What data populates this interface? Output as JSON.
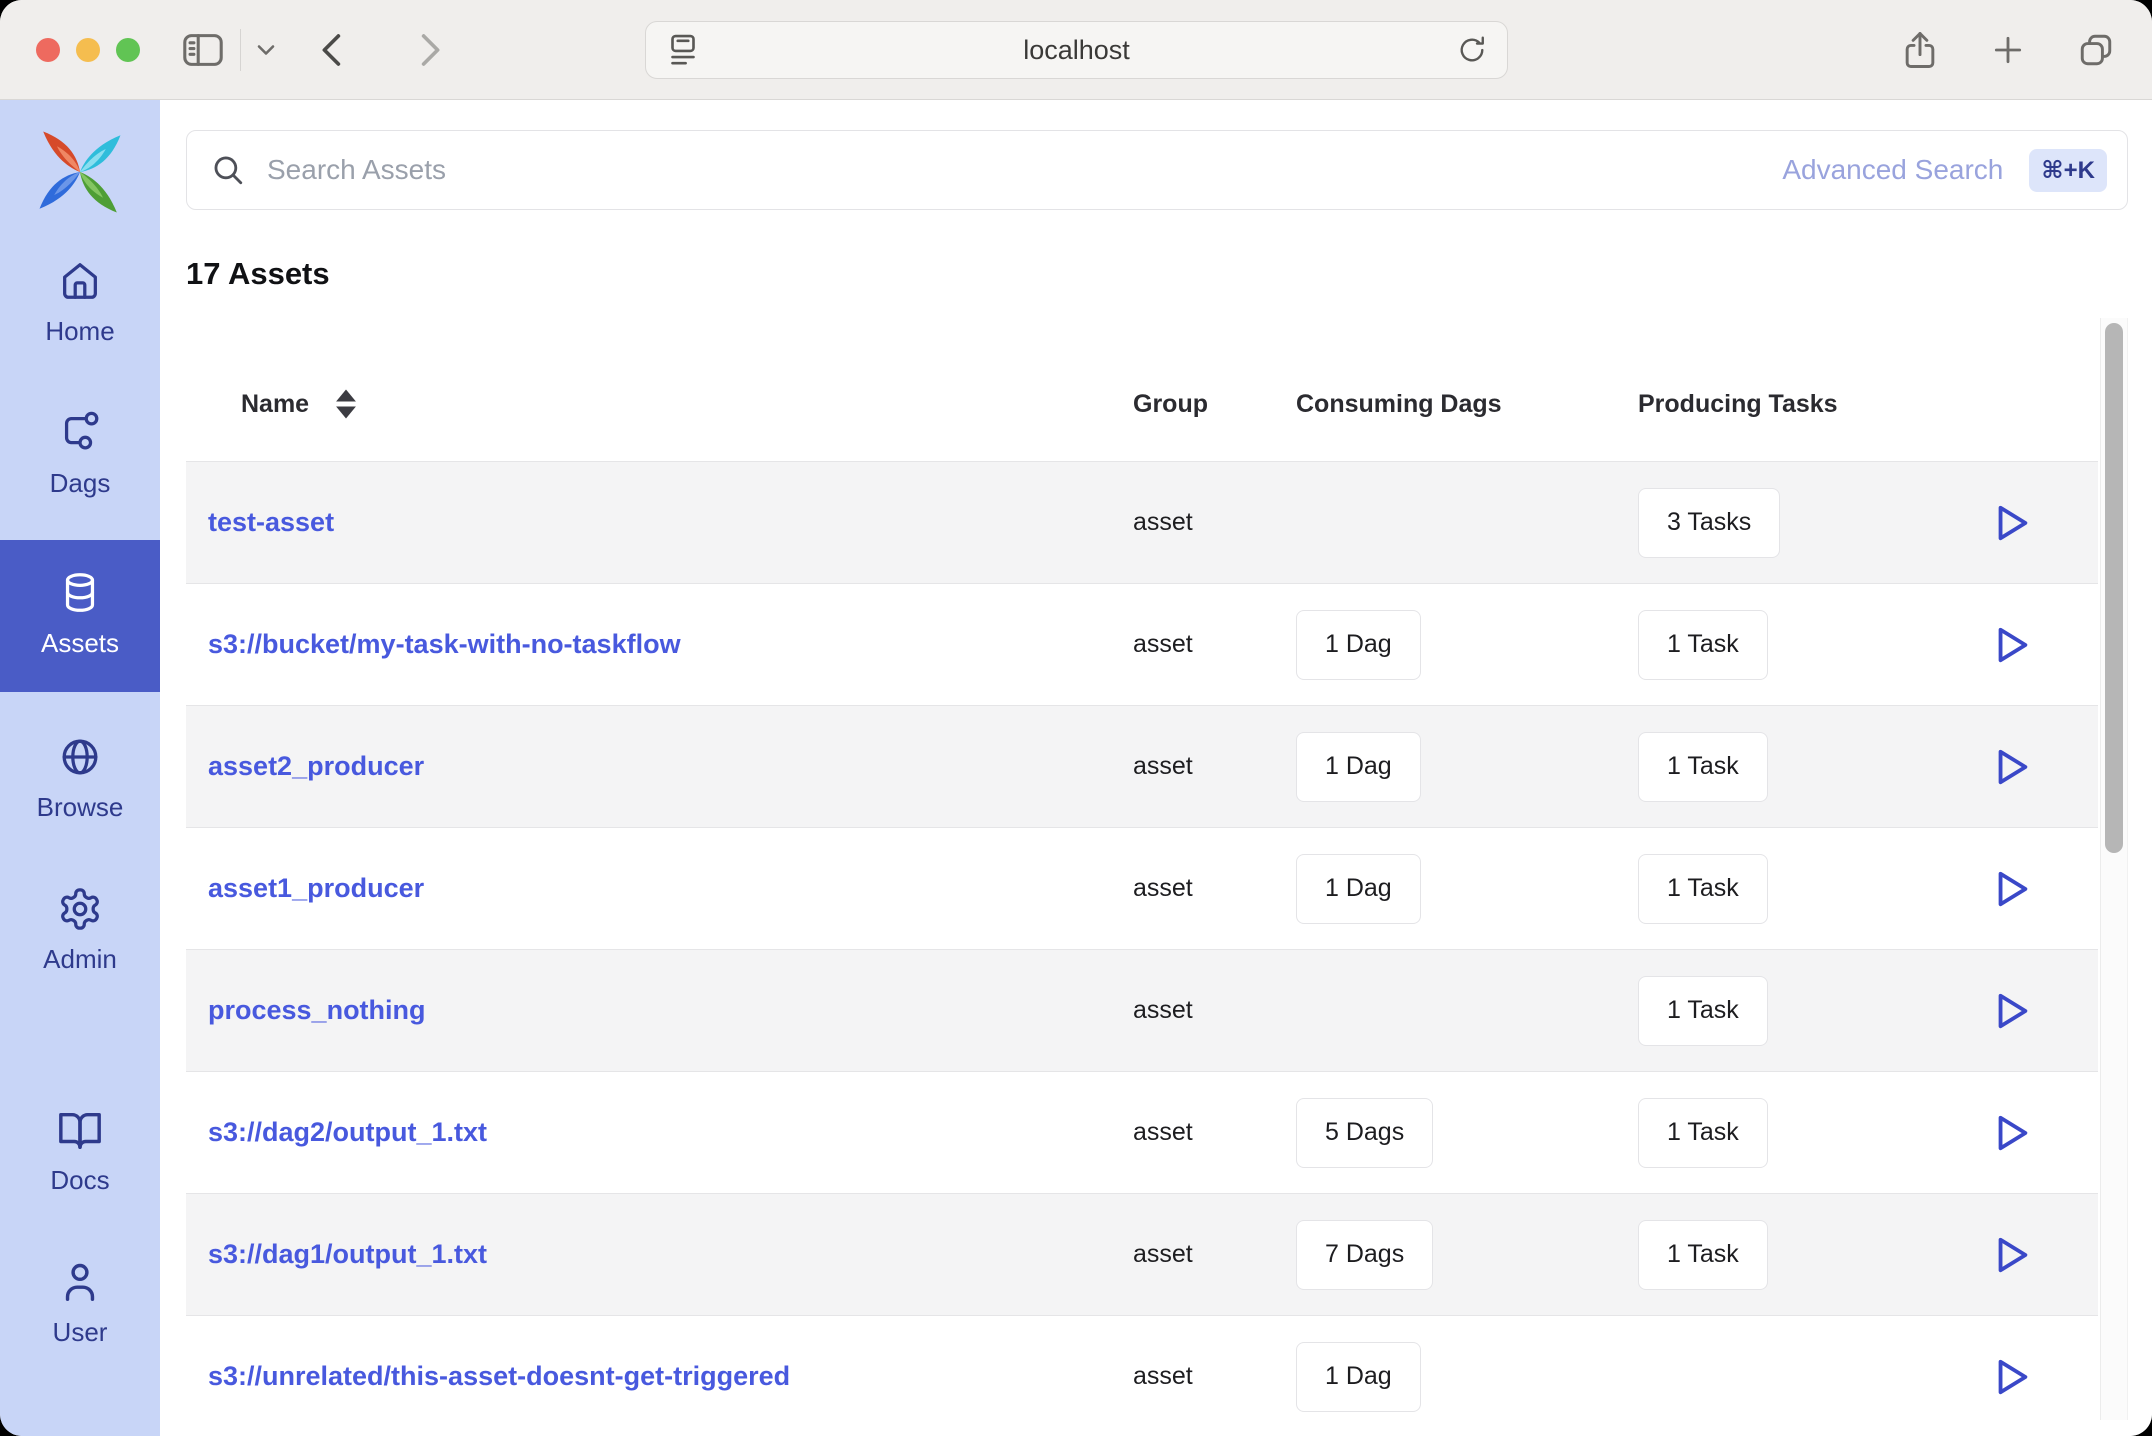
{
  "browser": {
    "url": "localhost"
  },
  "sidebar": {
    "items": [
      {
        "label": "Home",
        "icon": "home-icon",
        "active": false
      },
      {
        "label": "Dags",
        "icon": "dag-icon",
        "active": false
      },
      {
        "label": "Assets",
        "icon": "database-icon",
        "active": true
      },
      {
        "label": "Browse",
        "icon": "globe-icon",
        "active": false
      },
      {
        "label": "Admin",
        "icon": "gear-icon",
        "active": false
      }
    ],
    "footer_items": [
      {
        "label": "Docs",
        "icon": "book-icon"
      },
      {
        "label": "User",
        "icon": "user-icon"
      }
    ]
  },
  "search": {
    "placeholder": "Search Assets",
    "advanced_label": "Advanced Search",
    "shortcut": "⌘+K"
  },
  "heading": "17 Assets",
  "table": {
    "columns": [
      "Name",
      "Group",
      "Consuming Dags",
      "Producing Tasks"
    ],
    "rows": [
      {
        "name": "test-asset",
        "group": "asset",
        "consuming": "",
        "producing": "3 Tasks"
      },
      {
        "name": "s3://bucket/my-task-with-no-taskflow",
        "group": "asset",
        "consuming": "1 Dag",
        "producing": "1 Task"
      },
      {
        "name": "asset2_producer",
        "group": "asset",
        "consuming": "1 Dag",
        "producing": "1 Task"
      },
      {
        "name": "asset1_producer",
        "group": "asset",
        "consuming": "1 Dag",
        "producing": "1 Task"
      },
      {
        "name": "process_nothing",
        "group": "asset",
        "consuming": "",
        "producing": "1 Task"
      },
      {
        "name": "s3://dag2/output_1.txt",
        "group": "asset",
        "consuming": "5 Dags",
        "producing": "1 Task"
      },
      {
        "name": "s3://dag1/output_1.txt",
        "group": "asset",
        "consuming": "7 Dags",
        "producing": "1 Task"
      },
      {
        "name": "s3://unrelated/this-asset-doesnt-get-triggered",
        "group": "asset",
        "consuming": "1 Dag",
        "producing": ""
      }
    ]
  },
  "colors": {
    "sidebar_bg": "#c8d5f7",
    "sidebar_active_bg": "#4a5cc6",
    "sidebar_text": "#2e3a8c",
    "link": "#4859de",
    "play_icon": "#3a48c8",
    "row_alt_bg": "#f4f4f5",
    "shortcut_badge_bg": "#dde5fa",
    "advanced_search_text": "#99a3dd",
    "traffic_red": "#ee6a5f",
    "traffic_yellow": "#f5bd4f",
    "traffic_green": "#61c454"
  }
}
